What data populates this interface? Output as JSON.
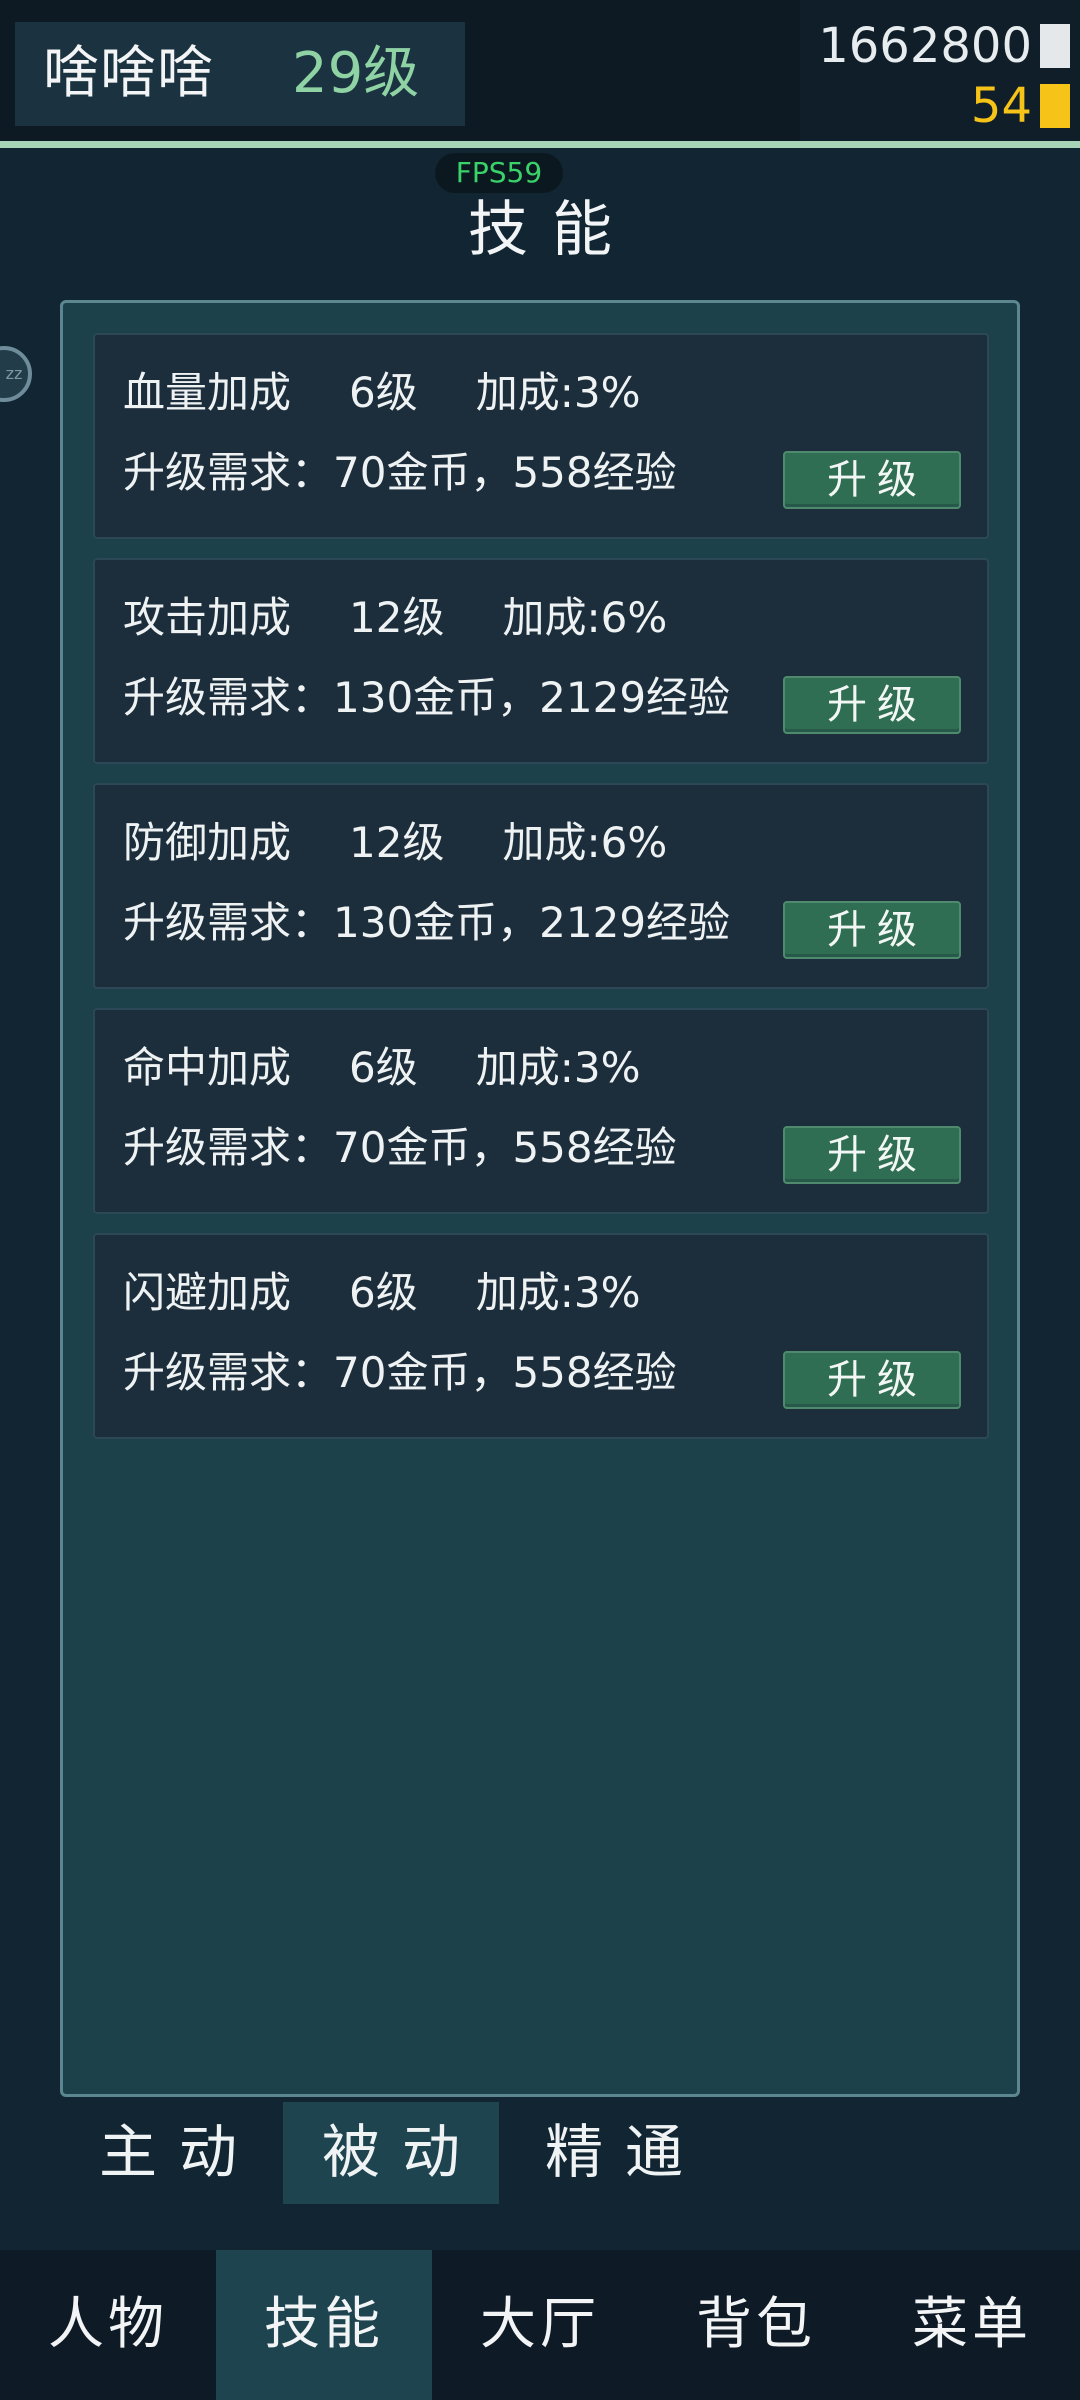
{
  "player": {
    "name": "啥啥啥",
    "level": "29级"
  },
  "resources": {
    "gold": "1662800",
    "gems": "54"
  },
  "fps": "FPS59",
  "title": "技能",
  "sleep_icon": "zz",
  "skills": [
    {
      "name": "血量加成",
      "level": "6级",
      "bonus": "加成:3%",
      "requirement": "升级需求：70金币，558经验",
      "button": "升级"
    },
    {
      "name": "攻击加成",
      "level": "12级",
      "bonus": "加成:6%",
      "requirement": "升级需求：130金币，2129经验",
      "button": "升级"
    },
    {
      "name": "防御加成",
      "level": "12级",
      "bonus": "加成:6%",
      "requirement": "升级需求：130金币，2129经验",
      "button": "升级"
    },
    {
      "name": "命中加成",
      "level": "6级",
      "bonus": "加成:3%",
      "requirement": "升级需求：70金币，558经验",
      "button": "升级"
    },
    {
      "name": "闪避加成",
      "level": "6级",
      "bonus": "加成:3%",
      "requirement": "升级需求：70金币，558经验",
      "button": "升级"
    }
  ],
  "subtabs": [
    {
      "label": "主动",
      "active": false
    },
    {
      "label": "被动",
      "active": true
    },
    {
      "label": "精通",
      "active": false
    }
  ],
  "nav": [
    {
      "label": "人物",
      "active": false
    },
    {
      "label": "技能",
      "active": true
    },
    {
      "label": "大厅",
      "active": false
    },
    {
      "label": "背包",
      "active": false
    },
    {
      "label": "菜单",
      "active": false
    }
  ],
  "colors": {
    "accent_green": "#8fd3a4",
    "gem_yellow": "#f6c318",
    "button_green": "#2f6e52",
    "fps_green": "#39d36a"
  }
}
